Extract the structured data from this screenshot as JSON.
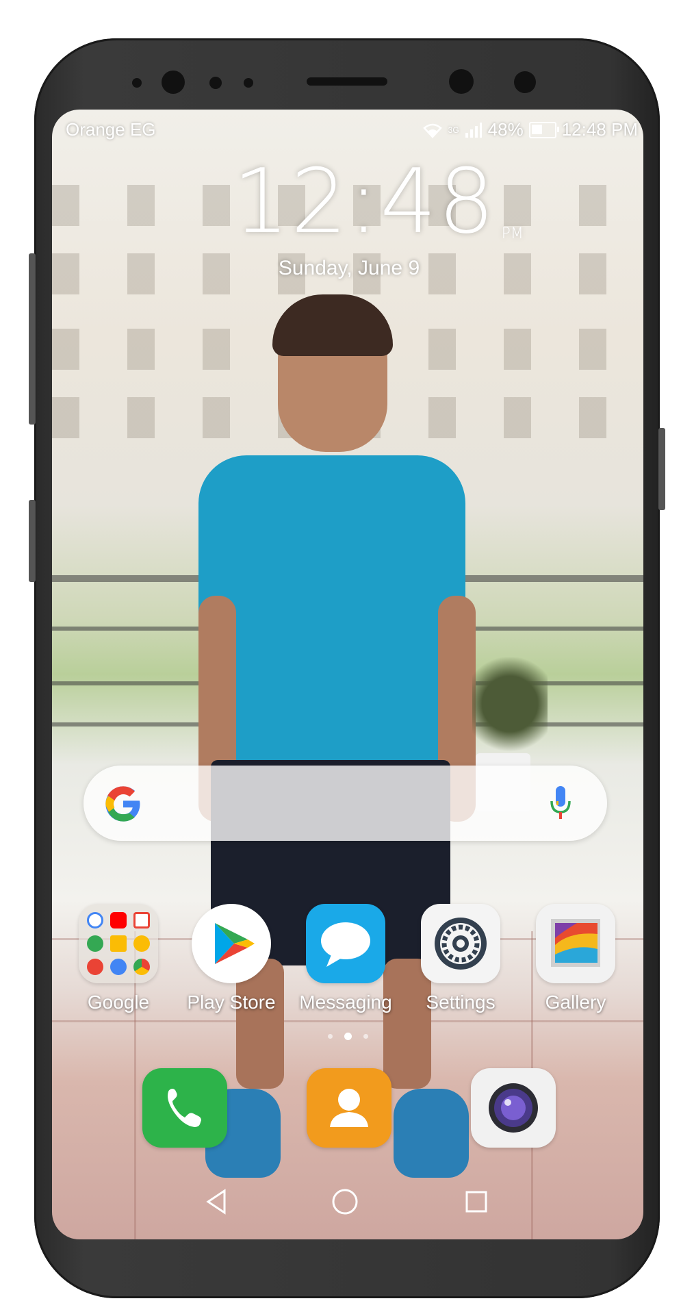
{
  "status_bar": {
    "carrier": "Orange EG",
    "network": "3G",
    "battery": "48%",
    "time": "12:48 PM"
  },
  "lockclock": {
    "time": "12:48",
    "ampm": "PM",
    "date": "Sunday, June 9"
  },
  "search_bar": {
    "logo_icon": "google-g-icon",
    "mic_icon": "microphone-icon"
  },
  "apps": [
    {
      "label": "Google",
      "icon": "google-folder-icon"
    },
    {
      "label": "Play Store",
      "icon": "play-store-icon"
    },
    {
      "label": "Messaging",
      "icon": "messaging-icon"
    },
    {
      "label": "Settings",
      "icon": "settings-gear-icon"
    },
    {
      "label": "Gallery",
      "icon": "gallery-icon"
    }
  ],
  "page_indicator": {
    "pages": 3,
    "current": 2
  },
  "dock": [
    {
      "icon": "phone-icon",
      "color": "#2db34a"
    },
    {
      "icon": "contacts-icon",
      "color": "#f29b1d"
    },
    {
      "icon": "camera-icon",
      "color": "#f1f1f1"
    }
  ],
  "navigation": {
    "back_icon": "back-triangle-icon",
    "home_icon": "home-circle-icon",
    "recents_icon": "recents-square-icon"
  },
  "colors": {
    "phone_body": "#333333",
    "shirt": "#1e9ec7",
    "status_text": "#ffffff"
  }
}
